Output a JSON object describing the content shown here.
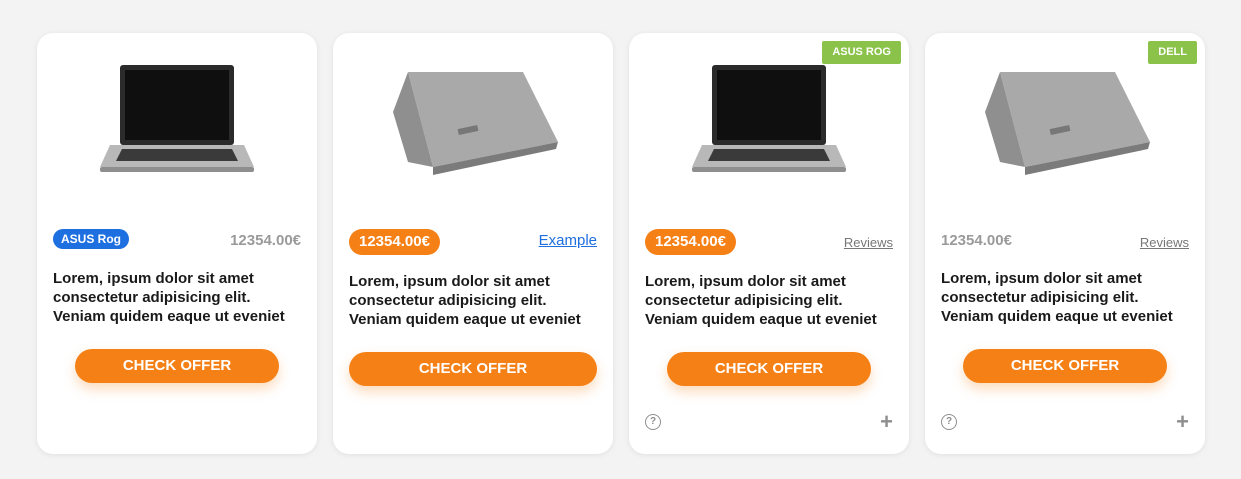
{
  "cards": [
    {
      "brand_pill": "ASUS Rog",
      "price": "12354.00€",
      "description": "Lorem, ipsum dolor sit amet consectetur adipisicing elit. Veniam quidem eaque ut eveniet",
      "cta": "CHECK OFFER",
      "image_icon": "laptop-front-icon"
    },
    {
      "price": "12354.00€",
      "link": "Example",
      "description": "Lorem, ipsum dolor sit amet consectetur adipisicing elit. Veniam quidem eaque ut eveniet",
      "cta": "CHECK OFFER",
      "image_icon": "laptop-back-icon"
    },
    {
      "badge": "ASUS ROG",
      "price": "12354.00€",
      "link": "Reviews",
      "description": "Lorem, ipsum dolor sit amet consectetur adipisicing elit. Veniam quidem eaque ut eveniet",
      "cta": "CHECK OFFER",
      "help_icon": "help-icon",
      "plus_icon": "plus-icon",
      "image_icon": "laptop-front-icon"
    },
    {
      "badge": "DELL",
      "price": "12354.00€",
      "link": "Reviews",
      "description": "Lorem, ipsum dolor sit amet consectetur adipisicing elit. Veniam quidem eaque ut eveniet",
      "cta": "CHECK OFFER",
      "help_icon": "help-icon",
      "plus_icon": "plus-icon",
      "image_icon": "laptop-back-icon"
    }
  ],
  "colors": {
    "accent_orange": "#f58016",
    "brand_blue": "#1e6fe0",
    "badge_green": "#8bc34a",
    "muted_gray": "#9a9a9a"
  }
}
